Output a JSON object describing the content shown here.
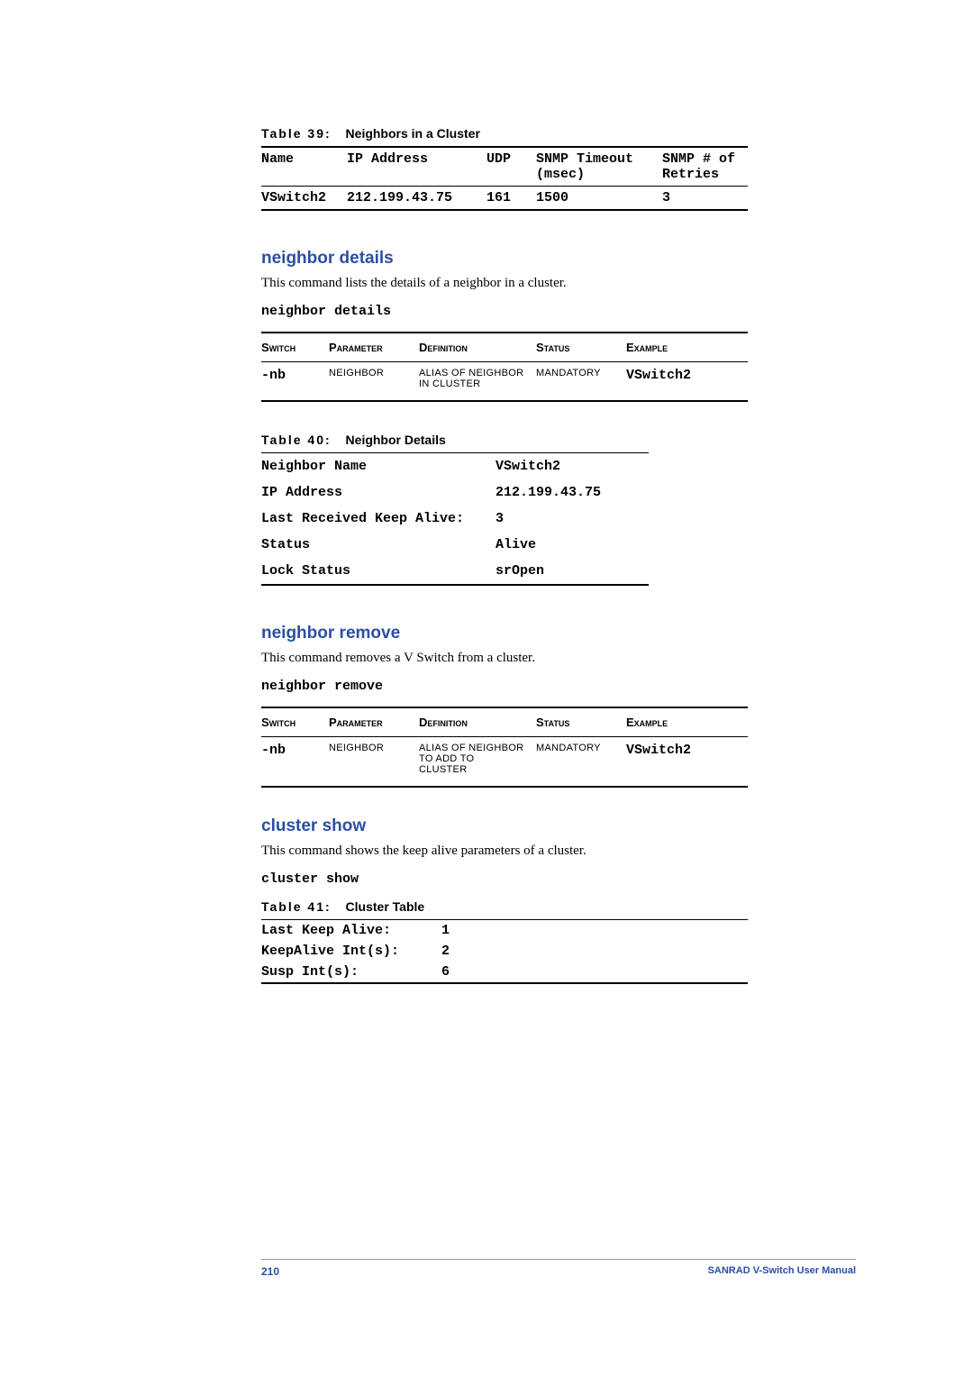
{
  "table39": {
    "caption_num": "Table 39:",
    "caption_title": "Neighbors in a Cluster",
    "headers": {
      "name": "Name",
      "ip": "IP Address",
      "udp": "UDP",
      "snmp_timeout_l1": "SNMP Timeout",
      "snmp_timeout_l2": "(msec)",
      "snmp_retries_l1": "SNMP # of",
      "snmp_retries_l2": "Retries"
    },
    "row": {
      "name": "VSwitch2",
      "ip": "212.199.43.75",
      "udp": "161",
      "timeout": "1500",
      "retries": "3"
    }
  },
  "neighbor_details": {
    "heading": "neighbor details",
    "desc": "This command lists the details of a neighbor in a cluster.",
    "cmd": "neighbor details",
    "ptable": {
      "headers": {
        "sw": "Switch",
        "pm": "Parameter",
        "df": "Definition",
        "st": "Status",
        "ex": "Example"
      },
      "row": {
        "sw": "-nb",
        "pm": "NEIGHBOR",
        "df_l1": "ALIAS OF NEIGHBOR",
        "df_l2": "IN CLUSTER",
        "st": "MANDATORY",
        "ex": "VSwitch2"
      }
    }
  },
  "table40": {
    "caption_num": "Table 40:",
    "caption_title": "Neighbor Details",
    "rows": [
      {
        "k": "Neighbor Name",
        "v": "VSwitch2"
      },
      {
        "k": "IP Address",
        "v": "212.199.43.75"
      },
      {
        "k": "Last Received Keep Alive:",
        "v": "3"
      },
      {
        "k": "Status",
        "v": "Alive"
      },
      {
        "k": "Lock Status",
        "v": "srOpen"
      }
    ]
  },
  "neighbor_remove": {
    "heading": "neighbor remove",
    "desc": "This command removes a V Switch from a cluster.",
    "cmd": "neighbor remove",
    "ptable": {
      "headers": {
        "sw": "Switch",
        "pm": "Parameter",
        "df": "Definition",
        "st": "Status",
        "ex": "Example"
      },
      "row": {
        "sw": "-nb",
        "pm": "NEIGHBOR",
        "df_l1": "ALIAS OF NEIGHBOR",
        "df_l2": "TO ADD TO",
        "df_l3": "CLUSTER",
        "st": "MANDATORY",
        "ex": "VSwitch2"
      }
    }
  },
  "cluster_show": {
    "heading": "cluster show",
    "desc": "This command shows the keep alive parameters of a cluster.",
    "cmd": "cluster show"
  },
  "table41": {
    "caption_num": "Table 41:",
    "caption_title": "Cluster Table",
    "rows": [
      {
        "k": "Last Keep Alive:",
        "v": "1"
      },
      {
        "k": "KeepAlive Int(s):",
        "v": "2"
      },
      {
        "k": "Susp Int(s):",
        "v": "6"
      }
    ]
  },
  "footer": {
    "page": "210",
    "manual": "SANRAD V-Switch User Manual"
  }
}
